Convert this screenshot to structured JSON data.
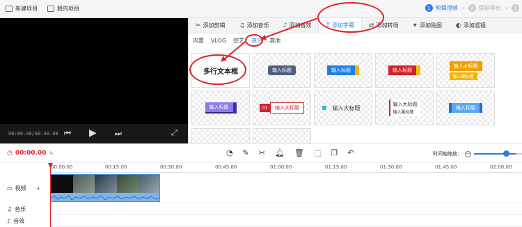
{
  "topbar": {
    "new_project": "新建项目",
    "my_projects": "我的项目",
    "steps": [
      {
        "num": "1",
        "label": "剪辑视频"
      },
      {
        "num": "2",
        "label": "保存导出"
      },
      {
        "num": "3",
        "label": ""
      }
    ]
  },
  "preview": {
    "time": "00:00.00/00:30.08"
  },
  "tabs": [
    {
      "icon": "✂",
      "label": "添加剪辑"
    },
    {
      "icon": "♫",
      "label": "添加音乐"
    },
    {
      "icon": "♪",
      "label": "添加音效"
    },
    {
      "icon": "T",
      "label": "添加字幕"
    },
    {
      "icon": "⇄",
      "label": "添加转场"
    },
    {
      "icon": "✦",
      "label": "添加贴图"
    },
    {
      "icon": "◐",
      "label": "添加滤镜"
    }
  ],
  "subtabs": [
    "内置",
    "VLOG",
    "综艺",
    "资讯",
    "其他"
  ],
  "templates": {
    "t1": "多行文本框",
    "t2": "输入标题",
    "t3": "输入标题",
    "t4": "输入标题",
    "t5a": "输入大标题",
    "t5b": "输入副标题",
    "t6": "输入标题",
    "t7_num": "01",
    "t7": "输入大标题",
    "t8": "输入大标题",
    "t9a": "输入大标题",
    "t9b": "输入副标题",
    "t10": "输入标题"
  },
  "toolbar": {
    "time": "00:00.00",
    "zoom_label": "时间轴缩放："
  },
  "timeline": {
    "ticks": [
      "00:00.00",
      "00:15.00",
      "00:30.00",
      "00:45.00",
      "01:00.00",
      "01:15.00",
      "01:30.00",
      "01:45.00",
      "02:00.00"
    ],
    "tracks": {
      "video": "视频",
      "music": "音乐",
      "sfx": "音效"
    }
  },
  "colors": {
    "accent": "#2d7be5",
    "annotation": "#e0212a"
  }
}
